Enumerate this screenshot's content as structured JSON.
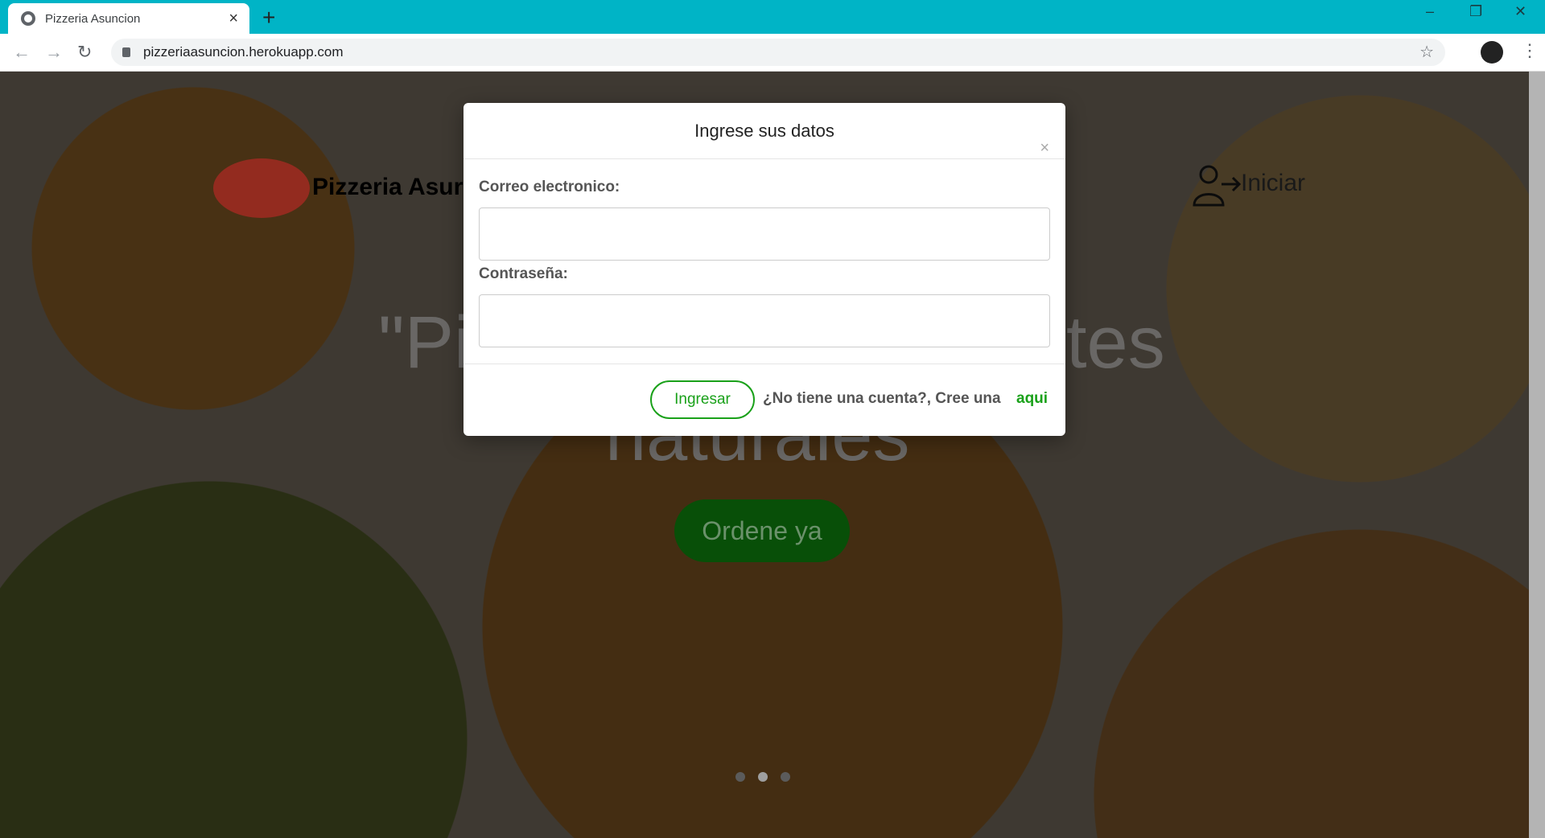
{
  "browser": {
    "tab_title": "Pizzeria Asuncion",
    "close_tab": "×",
    "new_tab": "+",
    "url": "pizzeriaasuncion.herokuapp.com",
    "window_minimize": "–",
    "window_restore": "❐",
    "window_close": "✕",
    "back": "←",
    "forward": "→",
    "reload": "↻",
    "bookmark": "☆",
    "menu": "⋮"
  },
  "site": {
    "brand": "Pizzeria Asur",
    "login_label": "Iniciar",
    "hero_line1_left": "\"Pi",
    "hero_line1_right": "tes",
    "hero_line2": "naturales",
    "order_button": "Ordene ya"
  },
  "modal": {
    "title": "Ingrese sus datos",
    "close": "×",
    "email_label": "Correo electronico:",
    "email_value": "",
    "password_label": "Contraseña:",
    "password_value": "",
    "submit": "Ingresar",
    "register_prompt": "¿No tiene una cuenta?, Cree una",
    "register_link": "aqui"
  },
  "colors": {
    "tabbar": "#00b4c6",
    "accent_green": "#1aa11a"
  }
}
